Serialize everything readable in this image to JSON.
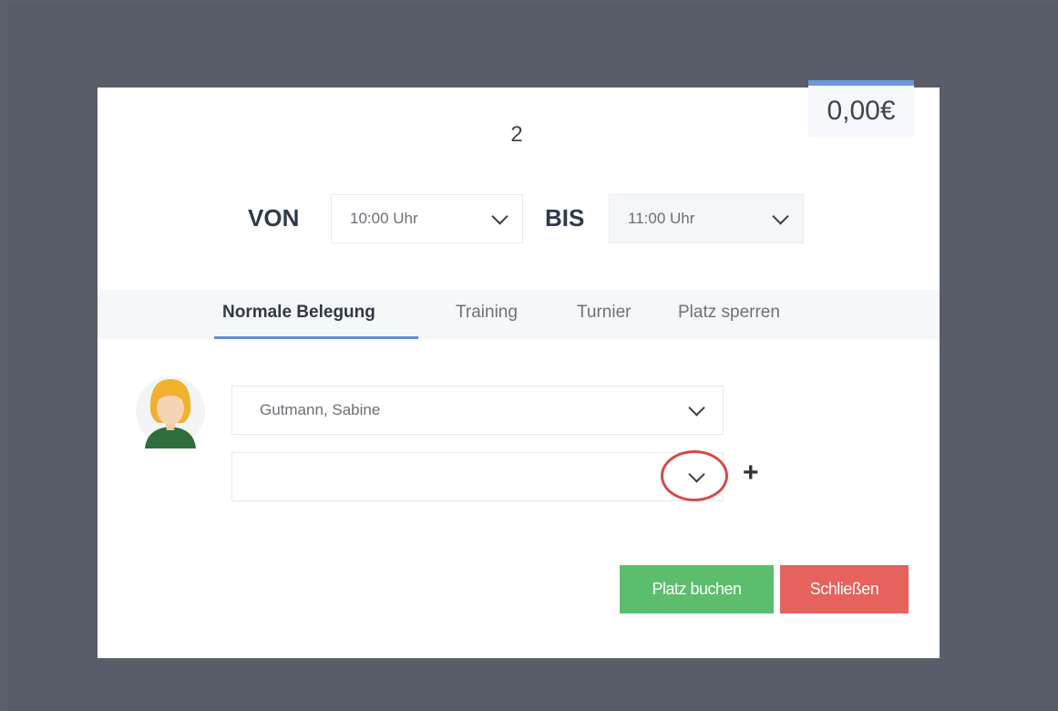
{
  "price": "0,00€",
  "court_number": "2",
  "time": {
    "from_label": "VON",
    "from_value": "10:00 Uhr",
    "to_label": "BIS",
    "to_value": "11:00 Uhr"
  },
  "tabs": [
    {
      "label": "Normale Belegung",
      "active": true
    },
    {
      "label": "Training",
      "active": false
    },
    {
      "label": "Turnier",
      "active": false
    },
    {
      "label": "Platz sperren",
      "active": false
    }
  ],
  "players": {
    "player1_value": "Gutmann, Sabine",
    "player2_value": "",
    "add_symbol": "+"
  },
  "buttons": {
    "book": "Platz buchen",
    "close": "Schließen"
  },
  "colors": {
    "accent_blue": "#5d8fd4",
    "book_green": "#5cbe6d",
    "close_red": "#e5625d",
    "annotation_red": "#d34a4a"
  }
}
